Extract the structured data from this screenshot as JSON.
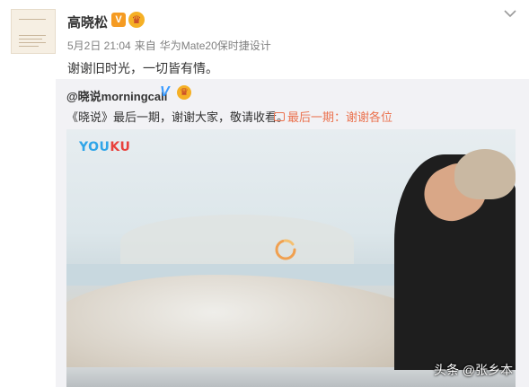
{
  "post": {
    "author": "高晓松",
    "verified_badge": "V",
    "time": "5月2日 21:04",
    "source_prefix": "来自",
    "source": "华为Mate20保时捷设计",
    "text": "谢谢旧时光，一切皆有情。"
  },
  "repost": {
    "user": "@晓说morningcall",
    "text": "《晓说》最后一期，谢谢大家，敬请收看。",
    "video_link": "最后一期：谢谢各位"
  },
  "video": {
    "logo_part1": "YOU",
    "logo_part2": "KU"
  },
  "watermark": "头条 @张乡本",
  "colors": {
    "link": "#eb7350",
    "youku_blue": "#2fa5e8",
    "youku_red": "#e8413c",
    "badge": "#f59b22"
  },
  "icons": [
    "avatar",
    "verified-badge",
    "crown-icon",
    "chevron-down-icon",
    "video-link-icon",
    "loading-spinner-icon"
  ]
}
